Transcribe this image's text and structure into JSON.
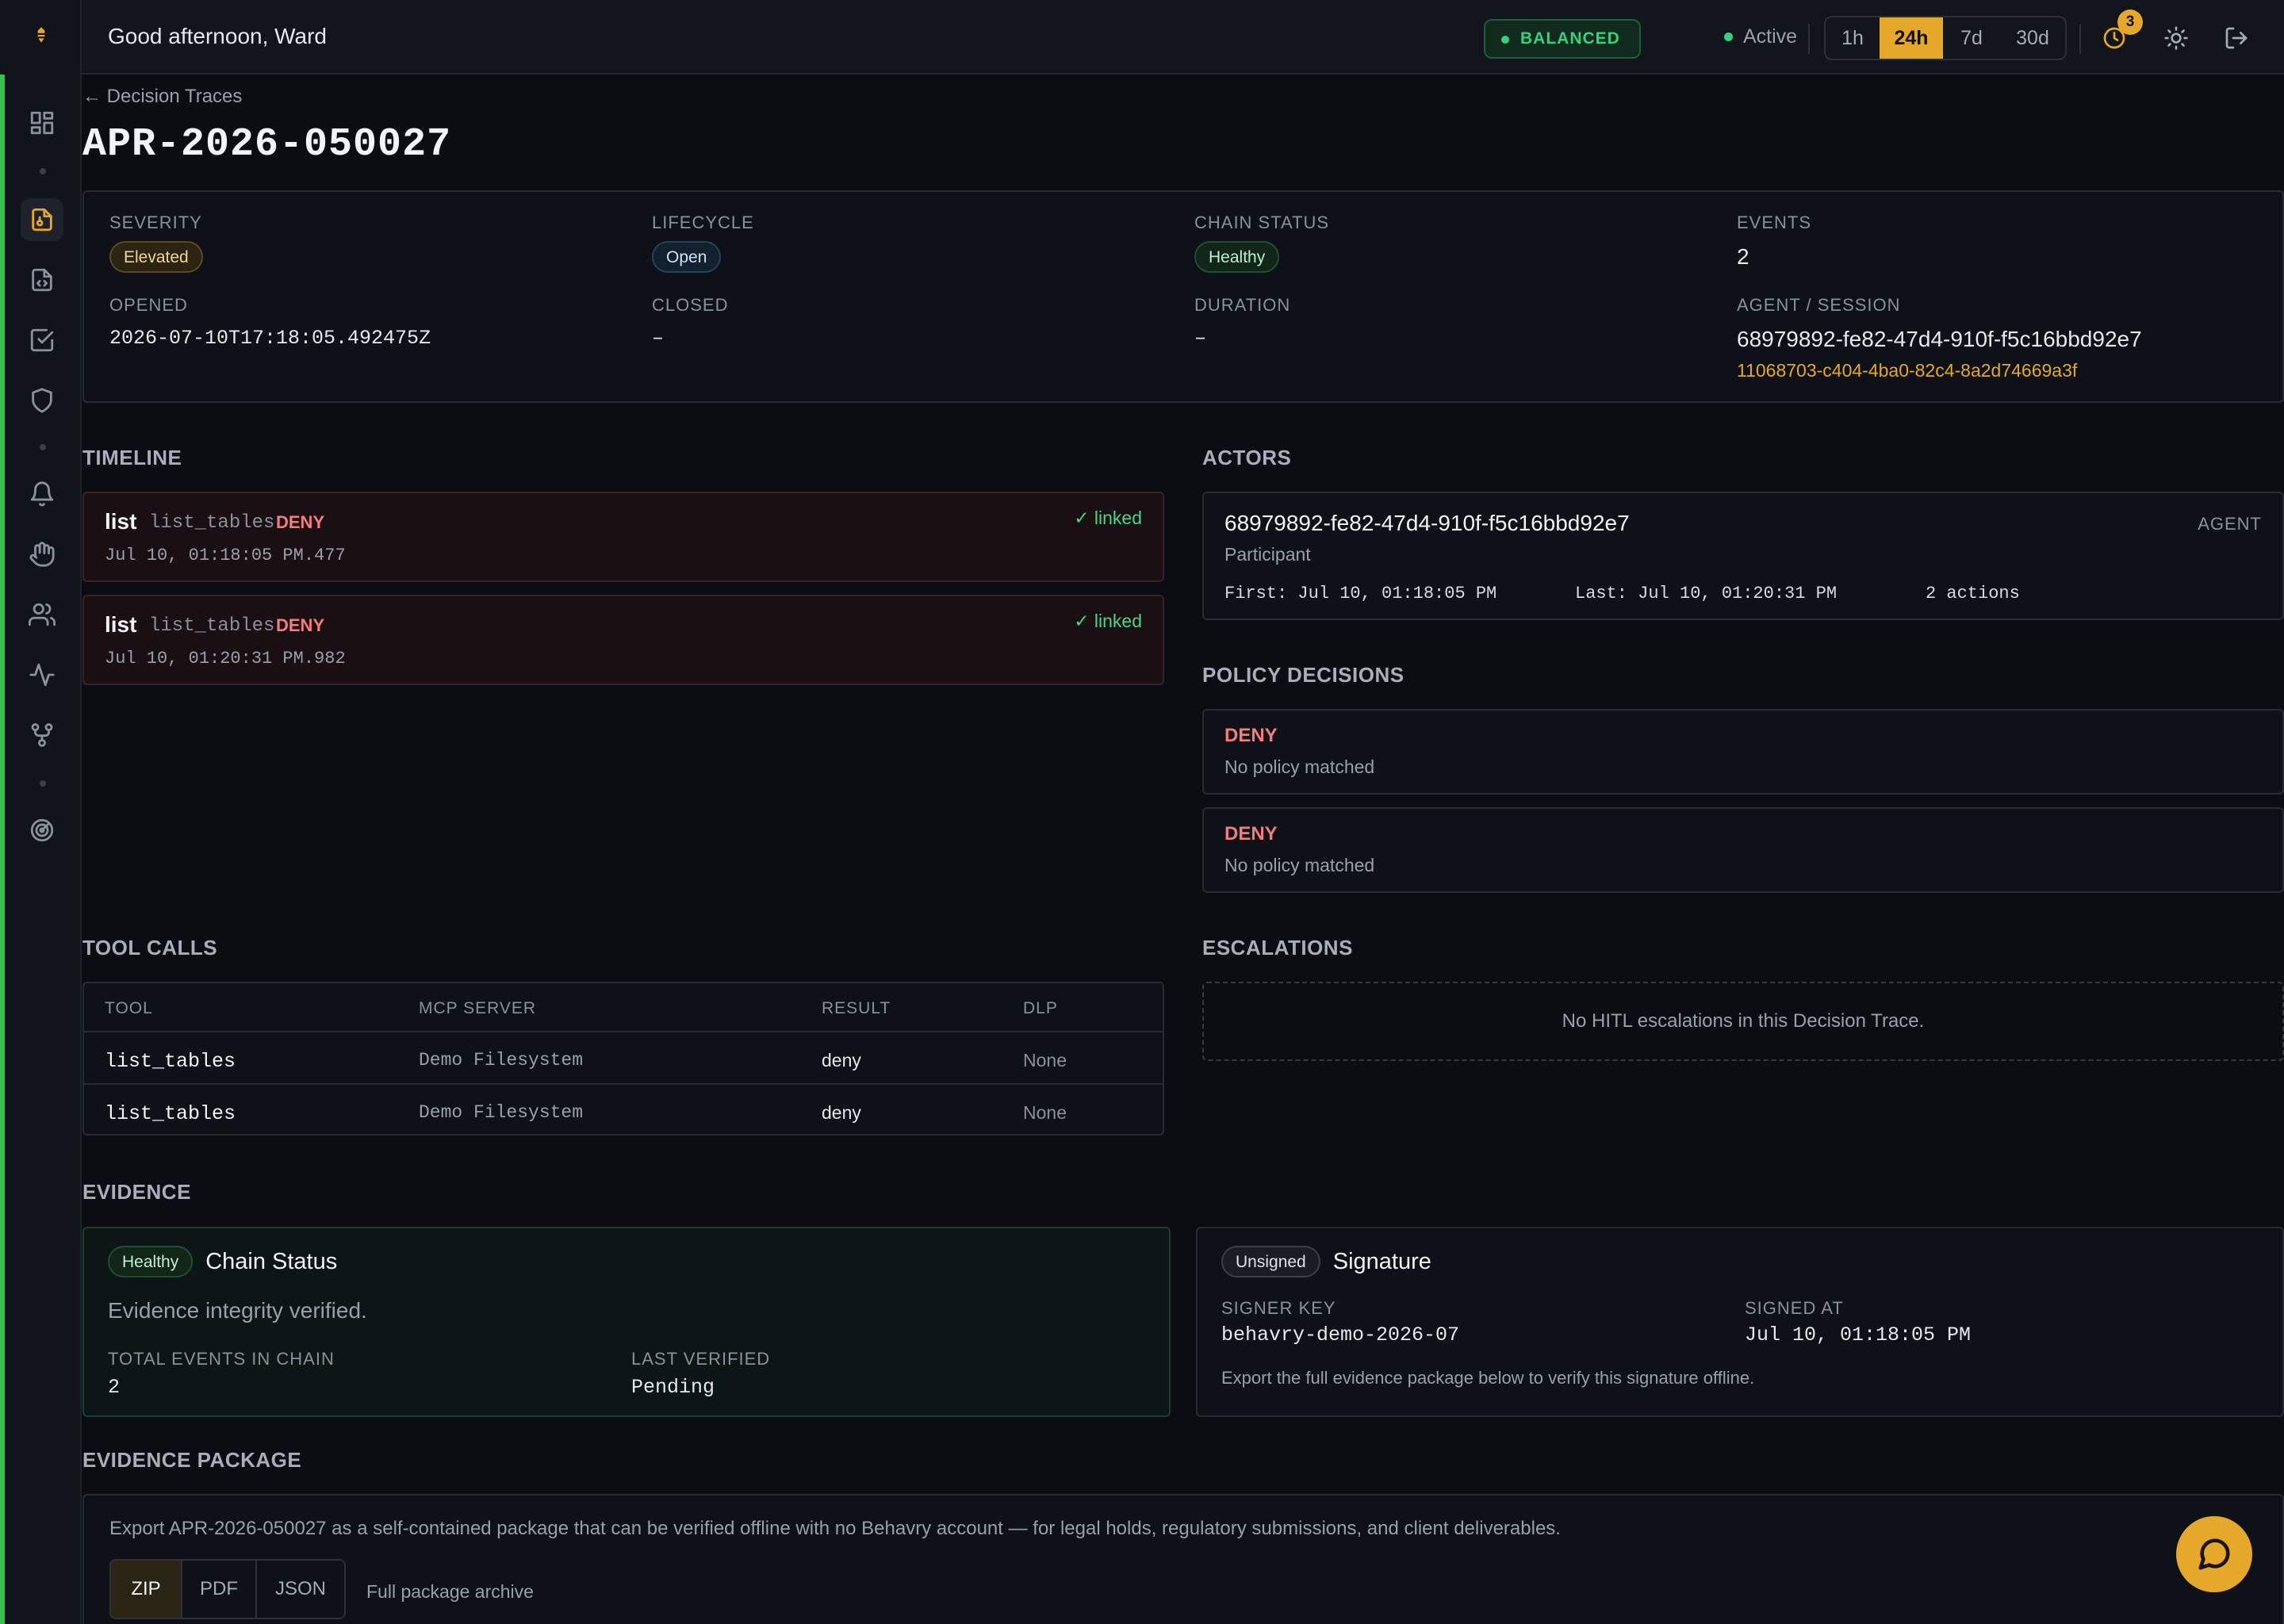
{
  "header": {
    "greeting": "Good afternoon, Ward",
    "mode": "BALANCED",
    "status": "Active",
    "ranges": [
      "1h",
      "24h",
      "7d",
      "30d"
    ],
    "selected_range": "24h",
    "notification_count": "3"
  },
  "sidebar": {
    "icons": [
      "dashboard-icon",
      "decision-traces-icon",
      "policy-code-icon",
      "tasks-check-icon",
      "shield-icon",
      "bell-icon",
      "hand-icon",
      "users-icon",
      "activity-icon",
      "integrations-icon",
      "radar-icon"
    ]
  },
  "breadcrumb": "← Decision Traces",
  "title": "APR-2026-050027",
  "summary": {
    "severity_label": "SEVERITY",
    "severity": "Elevated",
    "lifecycle_label": "LIFECYCLE",
    "lifecycle": "Open",
    "chain_status_label": "CHAIN STATUS",
    "chain_status": "Healthy",
    "events_label": "EVENTS",
    "events": "2",
    "opened_label": "OPENED",
    "opened": "2026-07-10T17:18:05.492475Z",
    "closed_label": "CLOSED",
    "closed": "–",
    "duration_label": "DURATION",
    "duration": "–",
    "agent_session_label": "AGENT / SESSION",
    "agent_id": "68979892-fe82-47d4-910f-f5c16bbd92e7",
    "session_id": "11068703-c404-4ba0-82c4-8a2d74669a3f"
  },
  "sections": {
    "timeline": "TIMELINE",
    "actors": "ACTORS",
    "policy_decisions": "POLICY DECISIONS",
    "tool_calls": "TOOL CALLS",
    "escalations": "ESCALATIONS",
    "evidence": "EVIDENCE",
    "evidence_package": "EVIDENCE PACKAGE"
  },
  "timeline": [
    {
      "verb": "list",
      "tool": "list_tables",
      "decision": "DENY",
      "time": "Jul 10, 01:18:05 PM.477",
      "linked": "✓ linked"
    },
    {
      "verb": "list",
      "tool": "list_tables",
      "decision": "DENY",
      "time": "Jul 10, 01:20:31 PM.982",
      "linked": "✓ linked"
    }
  ],
  "actors": [
    {
      "id": "68979892-fe82-47d4-910f-f5c16bbd92e7",
      "role": "Participant",
      "type": "AGENT",
      "first": "First: Jul 10, 01:18:05 PM",
      "last": "Last: Jul 10, 01:20:31 PM",
      "actions": "2 actions"
    }
  ],
  "policy_decisions": [
    {
      "decision": "DENY",
      "message": "No policy matched"
    },
    {
      "decision": "DENY",
      "message": "No policy matched"
    }
  ],
  "tool_calls": {
    "columns": [
      "TOOL",
      "MCP SERVER",
      "RESULT",
      "DLP"
    ],
    "rows": [
      {
        "tool": "list_tables",
        "server": "Demo Filesystem",
        "result": "deny",
        "dlp": "None"
      },
      {
        "tool": "list_tables",
        "server": "Demo Filesystem",
        "result": "deny",
        "dlp": "None"
      }
    ]
  },
  "escalations": {
    "empty": "No HITL escalations in this Decision Trace."
  },
  "evidence": {
    "chain": {
      "badge": "Healthy",
      "title": "Chain Status",
      "description": "Evidence integrity verified.",
      "total_label": "TOTAL EVENTS IN CHAIN",
      "total": "2",
      "verified_label": "LAST VERIFIED",
      "verified": "Pending"
    },
    "signature": {
      "badge": "Unsigned",
      "title": "Signature",
      "key_label": "SIGNER KEY",
      "key": "behavry-demo-2026-07",
      "signed_label": "SIGNED AT",
      "signed": "Jul 10, 01:18:05 PM",
      "note": "Export the full evidence package below to verify this signature offline."
    }
  },
  "package": {
    "description": "Export APR-2026-050027 as a self-contained package that can be verified offline with no Behavry account — for legal holds, regulatory submissions, and client deliverables.",
    "formats": [
      "ZIP",
      "PDF",
      "JSON"
    ],
    "selected_format": "ZIP",
    "hint": "Full package archive"
  },
  "colors": {
    "accent": "#e5a82a",
    "deny": "#f47c7c",
    "healthy": "#34d27a",
    "background": "#0b0d12"
  }
}
